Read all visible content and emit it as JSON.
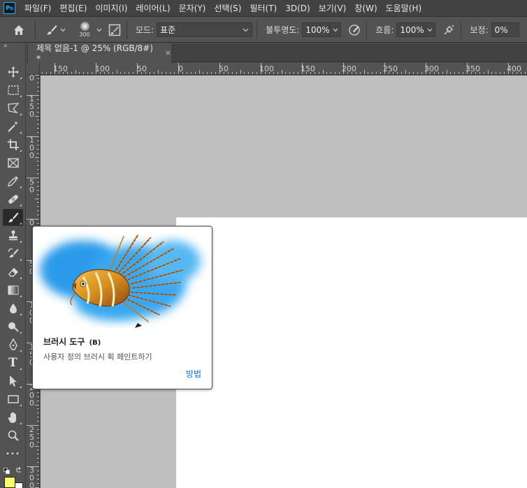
{
  "app": {
    "logo_text": "Ps"
  },
  "menu": [
    {
      "label": "파일(F)"
    },
    {
      "label": "편집(E)"
    },
    {
      "label": "이미지(I)"
    },
    {
      "label": "레이어(L)"
    },
    {
      "label": "문자(Y)"
    },
    {
      "label": "선택(S)"
    },
    {
      "label": "필터(T)"
    },
    {
      "label": "3D(D)"
    },
    {
      "label": "보기(V)"
    },
    {
      "label": "창(W)"
    },
    {
      "label": "도움말(H)"
    }
  ],
  "options": {
    "brush_size": "300",
    "mode_label": "모드:",
    "mode_value": "표준",
    "opacity_label": "불투명도:",
    "opacity_value": "100%",
    "flow_label": "흐름:",
    "flow_value": "100%",
    "smoothing_label": "보정:",
    "smoothing_value": "0%"
  },
  "document_tab": {
    "title": "제목 없음-1 @ 25% (RGB/8#) *",
    "close": "×"
  },
  "ruler": {
    "horizontal": [
      "150",
      "100",
      "50",
      "0",
      "50",
      "100",
      "150",
      "200",
      "250",
      "300",
      "350",
      "400"
    ],
    "vertical": [
      "0",
      "150",
      "100",
      "50",
      "0",
      "50",
      "100",
      "150",
      "200",
      "250",
      "300"
    ]
  },
  "toolbar": {
    "collapse": "»",
    "tools": [
      {
        "name": "move-tool"
      },
      {
        "name": "marquee-tool"
      },
      {
        "name": "lasso-tool"
      },
      {
        "name": "magic-wand-tool"
      },
      {
        "name": "crop-tool"
      },
      {
        "name": "frame-tool"
      },
      {
        "name": "eyedropper-tool"
      },
      {
        "name": "healing-brush-tool"
      },
      {
        "name": "brush-tool",
        "active": true
      },
      {
        "name": "clone-stamp-tool"
      },
      {
        "name": "history-brush-tool"
      },
      {
        "name": "eraser-tool"
      },
      {
        "name": "gradient-tool"
      },
      {
        "name": "blur-tool"
      },
      {
        "name": "dodge-tool"
      },
      {
        "name": "pen-tool"
      },
      {
        "name": "type-tool",
        "label": "T"
      },
      {
        "name": "path-selection-tool"
      },
      {
        "name": "rectangle-tool"
      },
      {
        "name": "hand-tool"
      },
      {
        "name": "zoom-tool"
      },
      {
        "name": "more-tools",
        "label": "•••"
      }
    ],
    "foreground_color": "#ffff66",
    "background_color": "#ffffff"
  },
  "tooltip": {
    "title": "브러시 도구",
    "shortcut": "(B)",
    "description": "사용자 정의 브러시 획 페인트하기",
    "link": "방법"
  }
}
